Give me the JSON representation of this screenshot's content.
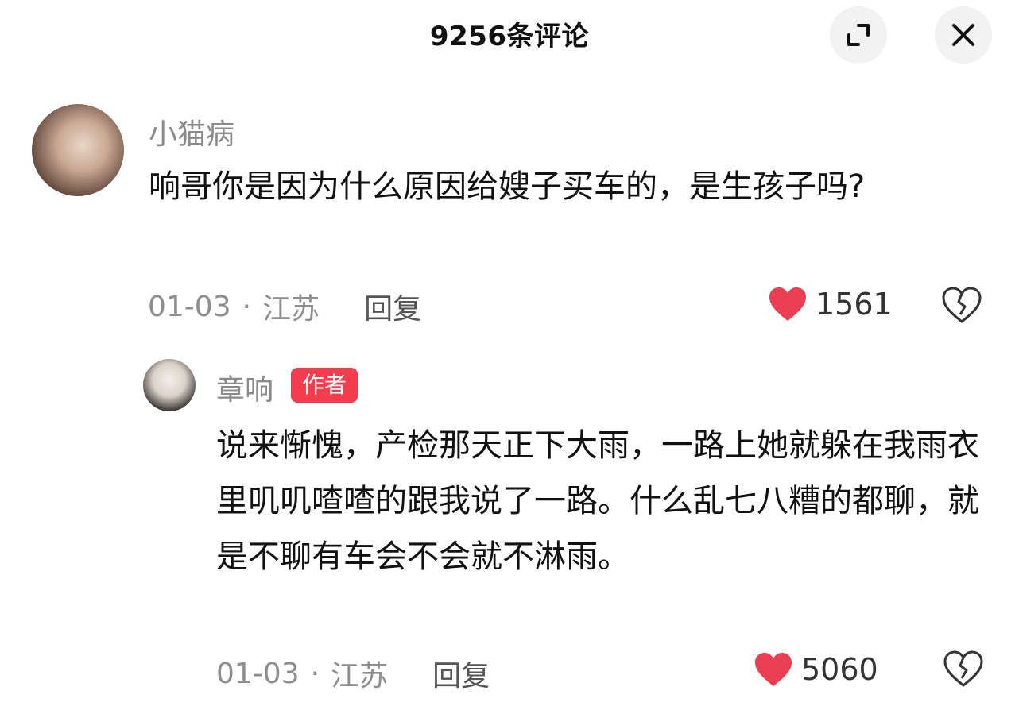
{
  "header": {
    "title": "9256条评论",
    "expand_icon": "expand-icon",
    "close_icon": "close-icon"
  },
  "comments": [
    {
      "username": "小猫病",
      "text": "响哥你是因为什么原因给嫂子买车的，是生孩子吗?",
      "date": "01-03",
      "separator": "·",
      "location": "江苏",
      "reply_label": "回复",
      "likes": "1561"
    },
    {
      "username": "章响",
      "badge": "作者",
      "text": "说来惭愧，产检那天正下大雨，一路上她就躲在我雨衣里叽叽喳喳的跟我说了一路。什么乱七八糟的都聊，就是不聊有车会不会就不淋雨。",
      "date": "01-03",
      "separator": "·",
      "location": "江苏",
      "reply_label": "回复",
      "likes": "5060"
    }
  ],
  "colors": {
    "heart": "#ea3f52",
    "badge": "#f33d4f",
    "meta_text": "#8e8e8e"
  }
}
